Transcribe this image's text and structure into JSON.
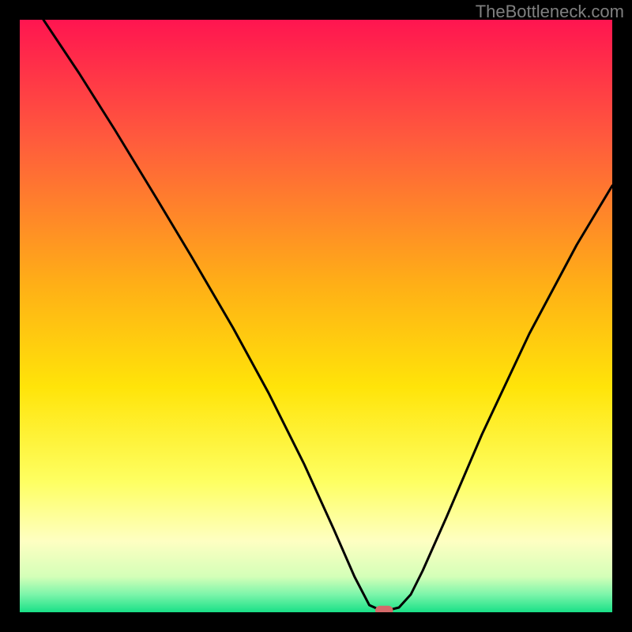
{
  "watermark": "TheBottleneck.com",
  "chart_data": {
    "type": "line",
    "title": "",
    "xlabel": "",
    "ylabel": "",
    "xlim": [
      0,
      100
    ],
    "ylim": [
      0,
      100
    ],
    "background_gradient": {
      "stops": [
        {
          "offset": 0,
          "color": "#ff1550"
        },
        {
          "offset": 20,
          "color": "#ff5a3d"
        },
        {
          "offset": 45,
          "color": "#ffb016"
        },
        {
          "offset": 62,
          "color": "#ffe409"
        },
        {
          "offset": 78,
          "color": "#feff62"
        },
        {
          "offset": 88,
          "color": "#feffc2"
        },
        {
          "offset": 94,
          "color": "#d4ffb8"
        },
        {
          "offset": 97,
          "color": "#7cf5aa"
        },
        {
          "offset": 100,
          "color": "#19e087"
        }
      ]
    },
    "series": [
      {
        "name": "bottleneck-curve",
        "x": [
          4,
          10,
          16,
          23,
          29,
          36,
          42,
          48,
          53,
          56.5,
          59,
          61,
          62,
          64,
          66,
          68,
          72,
          78,
          86,
          94,
          100
        ],
        "y": [
          100,
          91,
          81.5,
          70,
          60,
          48,
          37,
          25,
          14,
          6,
          1.2,
          0.3,
          0.3,
          0.8,
          3,
          7,
          16,
          30,
          47,
          62,
          72
        ]
      }
    ],
    "marker": {
      "name": "optimal-point",
      "x": 61.5,
      "y": 0.3,
      "color": "#d46a6a",
      "width": 3.0,
      "height": 1.6
    }
  }
}
